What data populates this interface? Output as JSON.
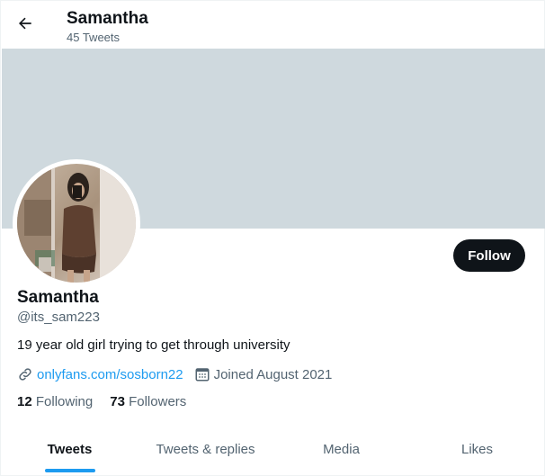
{
  "header": {
    "back_icon": "arrow-left-icon",
    "name": "Samantha",
    "tweet_count": "45 Tweets"
  },
  "banner": {
    "color": "#cfd9de"
  },
  "profile": {
    "display_name": "Samantha",
    "handle": "@its_sam223",
    "bio": "19 year old girl trying to get through university",
    "website": "onlyfans.com/sosborn22",
    "joined": "Joined August 2021",
    "following_count": "12",
    "following_label": "Following",
    "followers_count": "73",
    "followers_label": "Followers"
  },
  "actions": {
    "follow_label": "Follow"
  },
  "tabs": [
    {
      "label": "Tweets",
      "active": true
    },
    {
      "label": "Tweets & replies",
      "active": false
    },
    {
      "label": "Media",
      "active": false
    },
    {
      "label": "Likes",
      "active": false
    }
  ],
  "colors": {
    "accent": "#1d9bf0",
    "text_primary": "#0f1419",
    "text_secondary": "#536471",
    "follow_bg": "#0f1419"
  },
  "icons": {
    "link": "link-icon",
    "calendar": "calendar-icon"
  }
}
